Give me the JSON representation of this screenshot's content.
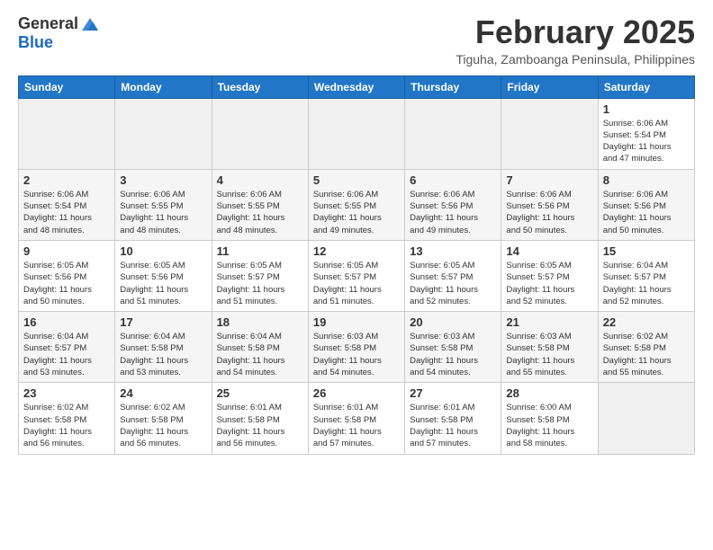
{
  "header": {
    "logo_general": "General",
    "logo_blue": "Blue",
    "main_title": "February 2025",
    "subtitle": "Tiguha, Zamboanga Peninsula, Philippines"
  },
  "days_of_week": [
    "Sunday",
    "Monday",
    "Tuesday",
    "Wednesday",
    "Thursday",
    "Friday",
    "Saturday"
  ],
  "weeks": [
    [
      {
        "day": "",
        "info": ""
      },
      {
        "day": "",
        "info": ""
      },
      {
        "day": "",
        "info": ""
      },
      {
        "day": "",
        "info": ""
      },
      {
        "day": "",
        "info": ""
      },
      {
        "day": "",
        "info": ""
      },
      {
        "day": "1",
        "info": "Sunrise: 6:06 AM\nSunset: 5:54 PM\nDaylight: 11 hours\nand 47 minutes."
      }
    ],
    [
      {
        "day": "2",
        "info": "Sunrise: 6:06 AM\nSunset: 5:54 PM\nDaylight: 11 hours\nand 48 minutes."
      },
      {
        "day": "3",
        "info": "Sunrise: 6:06 AM\nSunset: 5:55 PM\nDaylight: 11 hours\nand 48 minutes."
      },
      {
        "day": "4",
        "info": "Sunrise: 6:06 AM\nSunset: 5:55 PM\nDaylight: 11 hours\nand 48 minutes."
      },
      {
        "day": "5",
        "info": "Sunrise: 6:06 AM\nSunset: 5:55 PM\nDaylight: 11 hours\nand 49 minutes."
      },
      {
        "day": "6",
        "info": "Sunrise: 6:06 AM\nSunset: 5:56 PM\nDaylight: 11 hours\nand 49 minutes."
      },
      {
        "day": "7",
        "info": "Sunrise: 6:06 AM\nSunset: 5:56 PM\nDaylight: 11 hours\nand 50 minutes."
      },
      {
        "day": "8",
        "info": "Sunrise: 6:06 AM\nSunset: 5:56 PM\nDaylight: 11 hours\nand 50 minutes."
      }
    ],
    [
      {
        "day": "9",
        "info": "Sunrise: 6:05 AM\nSunset: 5:56 PM\nDaylight: 11 hours\nand 50 minutes."
      },
      {
        "day": "10",
        "info": "Sunrise: 6:05 AM\nSunset: 5:56 PM\nDaylight: 11 hours\nand 51 minutes."
      },
      {
        "day": "11",
        "info": "Sunrise: 6:05 AM\nSunset: 5:57 PM\nDaylight: 11 hours\nand 51 minutes."
      },
      {
        "day": "12",
        "info": "Sunrise: 6:05 AM\nSunset: 5:57 PM\nDaylight: 11 hours\nand 51 minutes."
      },
      {
        "day": "13",
        "info": "Sunrise: 6:05 AM\nSunset: 5:57 PM\nDaylight: 11 hours\nand 52 minutes."
      },
      {
        "day": "14",
        "info": "Sunrise: 6:05 AM\nSunset: 5:57 PM\nDaylight: 11 hours\nand 52 minutes."
      },
      {
        "day": "15",
        "info": "Sunrise: 6:04 AM\nSunset: 5:57 PM\nDaylight: 11 hours\nand 52 minutes."
      }
    ],
    [
      {
        "day": "16",
        "info": "Sunrise: 6:04 AM\nSunset: 5:57 PM\nDaylight: 11 hours\nand 53 minutes."
      },
      {
        "day": "17",
        "info": "Sunrise: 6:04 AM\nSunset: 5:58 PM\nDaylight: 11 hours\nand 53 minutes."
      },
      {
        "day": "18",
        "info": "Sunrise: 6:04 AM\nSunset: 5:58 PM\nDaylight: 11 hours\nand 54 minutes."
      },
      {
        "day": "19",
        "info": "Sunrise: 6:03 AM\nSunset: 5:58 PM\nDaylight: 11 hours\nand 54 minutes."
      },
      {
        "day": "20",
        "info": "Sunrise: 6:03 AM\nSunset: 5:58 PM\nDaylight: 11 hours\nand 54 minutes."
      },
      {
        "day": "21",
        "info": "Sunrise: 6:03 AM\nSunset: 5:58 PM\nDaylight: 11 hours\nand 55 minutes."
      },
      {
        "day": "22",
        "info": "Sunrise: 6:02 AM\nSunset: 5:58 PM\nDaylight: 11 hours\nand 55 minutes."
      }
    ],
    [
      {
        "day": "23",
        "info": "Sunrise: 6:02 AM\nSunset: 5:58 PM\nDaylight: 11 hours\nand 56 minutes."
      },
      {
        "day": "24",
        "info": "Sunrise: 6:02 AM\nSunset: 5:58 PM\nDaylight: 11 hours\nand 56 minutes."
      },
      {
        "day": "25",
        "info": "Sunrise: 6:01 AM\nSunset: 5:58 PM\nDaylight: 11 hours\nand 56 minutes."
      },
      {
        "day": "26",
        "info": "Sunrise: 6:01 AM\nSunset: 5:58 PM\nDaylight: 11 hours\nand 57 minutes."
      },
      {
        "day": "27",
        "info": "Sunrise: 6:01 AM\nSunset: 5:58 PM\nDaylight: 11 hours\nand 57 minutes."
      },
      {
        "day": "28",
        "info": "Sunrise: 6:00 AM\nSunset: 5:58 PM\nDaylight: 11 hours\nand 58 minutes."
      },
      {
        "day": "",
        "info": ""
      }
    ]
  ]
}
